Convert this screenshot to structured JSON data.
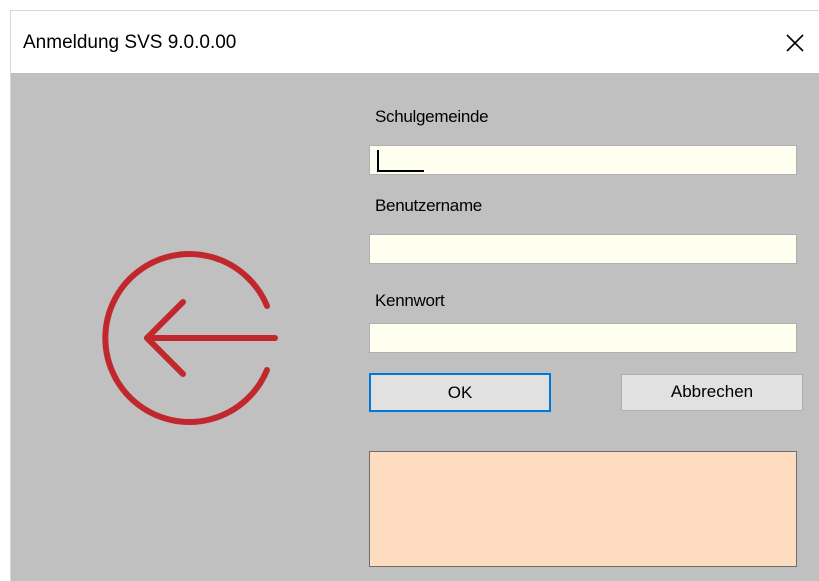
{
  "window": {
    "title": "Anmeldung SVS 9.0.0.00"
  },
  "form": {
    "school_label": "Schulgemeinde",
    "school_value": "",
    "user_label": "Benutzername",
    "user_value": "",
    "password_label": "Kennwort",
    "password_value": ""
  },
  "buttons": {
    "ok_label": "OK",
    "cancel_label": "Abbrechen"
  },
  "message": {
    "text": ""
  },
  "icons": {
    "logo": "login-arrow-icon",
    "close": "close-icon"
  },
  "colors": {
    "logo_red": "#c0282d",
    "field_bg": "#ffffef",
    "message_bg": "#fddcc0",
    "focus_border": "#0078d7",
    "client_bg": "#c0c0c0"
  }
}
